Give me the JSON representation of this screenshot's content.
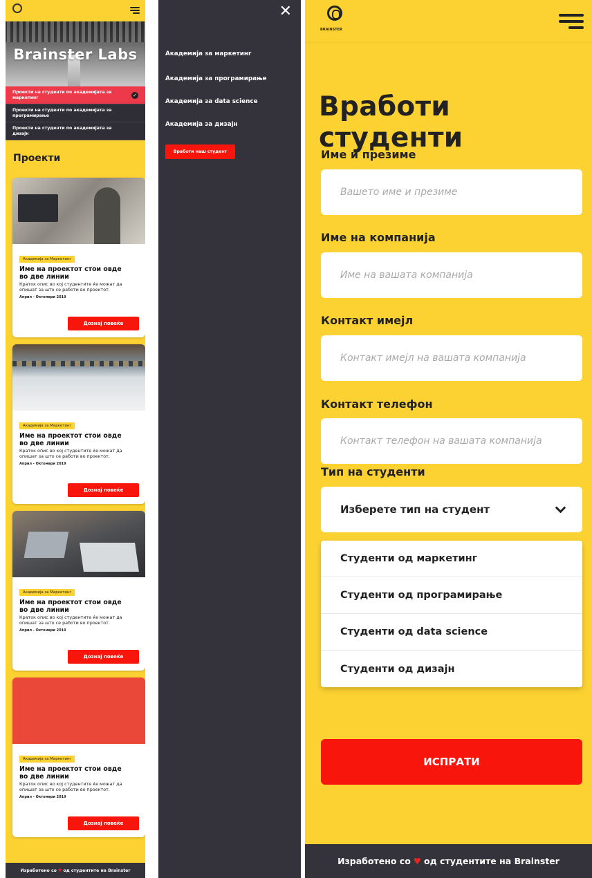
{
  "listing": {
    "hero_title": "Brainster Labs",
    "filters": [
      {
        "label": "Проекти на студенти по академијата за маркетинг",
        "active": true
      },
      {
        "label": "Проекти на студенти по академијата за програмирање",
        "active": false
      },
      {
        "label": "Проекти на студенти по академијата за дизајн",
        "active": false
      }
    ],
    "section_title": "Проекти",
    "cards": [
      {
        "tag": "Академија за Маркетинг",
        "title": "Име на проектот стои овде во две линии",
        "desc": "Краток опис во кој студентите ќе можат да опишат за што се работи во проектот.",
        "date": "Април - Октомври 2019",
        "button": "Дознај повеќе"
      },
      {
        "tag": "Академија за Маркетинг",
        "title": "Име на проектот стои овде во две линии",
        "desc": "Краток опис во кој студентите ќе можат да опишат за што се работи во проектот.",
        "date": "Април - Октомври 2019",
        "button": "Дознај повеќе"
      },
      {
        "tag": "Академија за Маркетинг",
        "title": "Име на проектот стои овде во две линии",
        "desc": "Краток опис во кој студентите ќе можат да опишат за што се работи во проектот.",
        "date": "Април - Октомври 2019",
        "button": "Дознај повеќе"
      },
      {
        "tag": "Академија за Маркетинг",
        "title": "Име на проектот стои овде во две линии",
        "desc": "Краток опис во кој студентите ќе можат да опишат за што се работи во проектот.",
        "date": "Април - Октомври 2019",
        "button": "Дознај повеќе"
      }
    ],
    "footer_before": "Изработено со",
    "footer_after": "од студентите на Brainster"
  },
  "menu": {
    "close_glyph": "✕",
    "items": [
      "Академија за маркетинг",
      "Академија за програмирање",
      "Академија за data science",
      "Академија за дизајн"
    ],
    "cta": "Вработи наш студент"
  },
  "form": {
    "logo_text": "BRAINSTER",
    "title": "Вработи студенти",
    "fields": [
      {
        "label": "Име и презиме",
        "placeholder": "Вашето име и презиме"
      },
      {
        "label": "Име на компанија",
        "placeholder": "Име на вашата компанија"
      },
      {
        "label": "Контакт имејл",
        "placeholder": "Контакт имејл на вашата компанија"
      },
      {
        "label": "Контакт телефон",
        "placeholder": "Контакт телефон на вашата компанија"
      }
    ],
    "type_label": "Тип на студенти",
    "select_value": "Изберете тип на студент",
    "options": [
      "Студенти од маркетинг",
      "Студенти од програмирање",
      "Студенти од data science",
      "Студенти од дизајн"
    ],
    "submit": "ИСПРАТИ",
    "footer_before": "Изработено со",
    "footer_after": "од студентите на Brainster"
  },
  "colors": {
    "yellow": "#fcd232",
    "red": "#f8150b",
    "dark": "#34333c",
    "pink": "#ed3a4a"
  }
}
